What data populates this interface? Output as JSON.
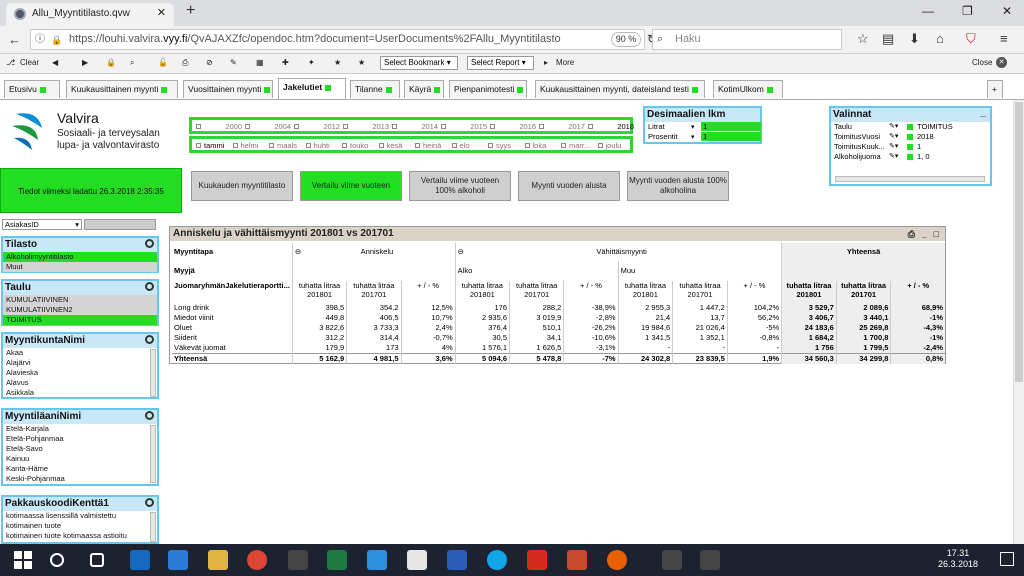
{
  "browser": {
    "tab_title": "Allu_Myyntitilasto.qvw",
    "url_prefix": "https://louhi.valvira.",
    "url_domain": "vyy.fi",
    "url_rest": "/QvAJAXZfc/opendoc.htm?document=UserDocuments%2FAllu_Myyntitilasto",
    "zoom": "90 %",
    "search_placeholder": "Haku"
  },
  "qv_toolbar": {
    "clear": "Clear",
    "bookmark": "Select Bookmark",
    "report": "Select Report",
    "more": "More",
    "close": "Close"
  },
  "sheet_tabs": [
    "Etusivu",
    "Kuukausittainen myynti",
    "Vuosittainen myynti",
    "Jakelutiet",
    "Tilanne",
    "Käyrä",
    "Pienpanimotesti",
    "Kuukausittainen myynti, dateisland testi",
    "KotimUlkom"
  ],
  "brand": {
    "name": "Valvira",
    "line1": "Sosiaali- ja terveysalan",
    "line2": "lupa- ja valvontavirasto"
  },
  "years": [
    "2000",
    "2004",
    "2012",
    "2013",
    "2014",
    "2015",
    "2016",
    "2017",
    "2018"
  ],
  "months": [
    "tammi",
    "helmi",
    "maals",
    "huhti",
    "touko",
    "kesä",
    "heinä",
    "elo",
    "syys",
    "loka",
    "marr...",
    "joulu"
  ],
  "decimals": {
    "title": "Desimaalien lkm",
    "rows": [
      {
        "label": "Litrat",
        "value": "1"
      },
      {
        "label": "Prosentit",
        "value": "1"
      }
    ]
  },
  "selections": {
    "title": "Valinnat",
    "rows": [
      {
        "field": "Taulu",
        "value": "TOIMITUS"
      },
      {
        "field": "ToimitusVuosi",
        "value": "2018"
      },
      {
        "field": "ToimitusKuuk...",
        "value": "1"
      },
      {
        "field": "Alkoholijuoma",
        "value": "1, 0"
      }
    ]
  },
  "updated": "Tiedot viimeksi ladattu 26.3.2018 2:35:35",
  "buttons": [
    "Kuukauden myyntitilasto",
    "Vertailu viime vuoteen",
    "Vertailu viime vuoteen 100% alkoholi",
    "Myynti vuoden alusta",
    "Myynti vuoden alusta 100% alkoholina"
  ],
  "asiakas": "AsiakasID",
  "tilasto": {
    "title": "Tilasto",
    "items": [
      "Alkoholimyyntitilasto",
      "Muut"
    ]
  },
  "taulu": {
    "title": "Taulu",
    "items": [
      "KUMULATIIVINEN",
      "KUMULATIIVINEN2",
      "TOIMITUS"
    ]
  },
  "kunta": {
    "title": "MyyntikuntaNimi",
    "items": [
      "Akaa",
      "Alajärvi",
      "Alavieska",
      "Alavus",
      "Asikkala"
    ]
  },
  "laani": {
    "title": "MyyntiläaniNimi",
    "items": [
      "Etelä-Karjala",
      "Etelä-Pohjanmaa",
      "Etelä-Savo",
      "Kainuu",
      "Kanta-Häme",
      "Keski-Pohjanmaa"
    ]
  },
  "pakkaus": {
    "title": "PakkauskoodiKenttä1",
    "items": [
      "kotimaassa lisenssillä valmistettu",
      "kotimainen tuote",
      "kotimainen tuote kotimaassa astioitu"
    ]
  },
  "table": {
    "title": "Anniskelu ja vähittäismyynti 201801 vs 201701",
    "h_myyntitapa": "Myyntitapa",
    "h_anniskelu": "Anniskelu",
    "h_vahittais": "Vähittäismyynti",
    "h_yhteensa": "Yhteensä",
    "h_myyja": "Myyjä",
    "h_alko": "Alko",
    "h_muu": "Muu",
    "h_group": "JuomaryhmänJakelutieraportti...",
    "col_a": "tuhatta litraa 201801",
    "col_b": "tuhatta litraa 201701",
    "col_c": "+ / - %",
    "rows": [
      {
        "name": "Long drink",
        "v": [
          "398,5",
          "354,2",
          "12,5%",
          "176",
          "288,2",
          "-38,9%",
          "2 955,3",
          "1 447,2",
          "104,2%",
          "3 529,7",
          "2 089,6",
          "68,9%"
        ]
      },
      {
        "name": "Miedot viinit",
        "v": [
          "449,8",
          "406,5",
          "10,7%",
          "2 935,6",
          "3 019,9",
          "-2,8%",
          "21,4",
          "13,7",
          "56,2%",
          "3 406,7",
          "3 440,1",
          "-1%"
        ]
      },
      {
        "name": "Oluet",
        "v": [
          "3 822,6",
          "3 733,3",
          "2,4%",
          "376,4",
          "510,1",
          "-26,2%",
          "19 984,6",
          "21 026,4",
          "-5%",
          "24 183,6",
          "25 269,8",
          "-4,3%"
        ]
      },
      {
        "name": "Siiderit",
        "v": [
          "312,2",
          "314,4",
          "-0,7%",
          "30,5",
          "34,1",
          "-10,6%",
          "1 341,5",
          "1 352,1",
          "-0,8%",
          "1 684,2",
          "1 700,8",
          "-1%"
        ]
      },
      {
        "name": "Väkevät juomat",
        "v": [
          "179,9",
          "173",
          "4%",
          "1 576,1",
          "1 626,5",
          "-3,1%",
          "-",
          "-",
          "-",
          "1 756",
          "1 799,5",
          "-2,4%"
        ]
      },
      {
        "name": "Yhteensä",
        "v": [
          "5 162,9",
          "4 981,5",
          "3,6%",
          "5 094,6",
          "5 478,8",
          "-7%",
          "24 302,8",
          "23 839,5",
          "1,9%",
          "34 560,3",
          "34 299,8",
          "0,8%"
        ]
      }
    ]
  },
  "clock": {
    "time": "17.31",
    "date": "26.3.2018"
  }
}
